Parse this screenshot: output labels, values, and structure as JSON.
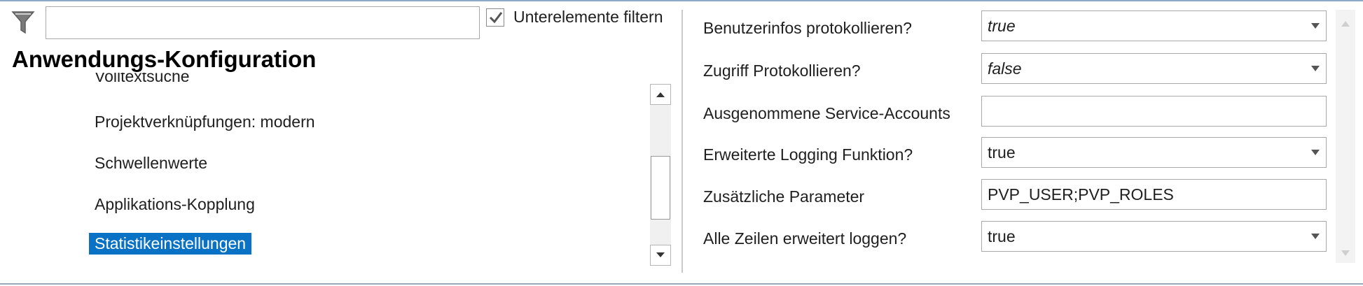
{
  "filter": {
    "icon": "funnel-icon",
    "value": "",
    "placeholder": "",
    "subelements_checked": true,
    "subelements_label": "Unterelemente filtern"
  },
  "section": {
    "title": "Anwendungs-Konfiguration"
  },
  "tree": {
    "items": [
      {
        "label": "Volltextsuche",
        "selected": false
      },
      {
        "label": "Projektverknüpfungen: modern",
        "selected": false
      },
      {
        "label": "Schwellenwerte",
        "selected": false
      },
      {
        "label": "Applikations-Kopplung",
        "selected": false
      },
      {
        "label": "Statistikeinstellungen",
        "selected": true
      }
    ]
  },
  "properties": [
    {
      "label": "Benutzerinfos protokollieren?",
      "value": "true",
      "kind": "dropdown",
      "italic": true
    },
    {
      "label": "Zugriff Protokollieren?",
      "value": "false",
      "kind": "dropdown",
      "italic": true
    },
    {
      "label": "Ausgenommene Service-Accounts",
      "value": "",
      "kind": "text",
      "italic": false
    },
    {
      "label": "Erweiterte Logging Funktion?",
      "value": "true",
      "kind": "dropdown",
      "italic": false
    },
    {
      "label": "Zusätzliche Parameter",
      "value": "PVP_USER;PVP_ROLES",
      "kind": "text",
      "italic": false
    },
    {
      "label": "Alle Zeilen erweitert loggen?",
      "value": "true",
      "kind": "dropdown",
      "italic": false
    }
  ],
  "colors": {
    "selection": "#0a72c4",
    "frame": "#8fa8c8"
  }
}
